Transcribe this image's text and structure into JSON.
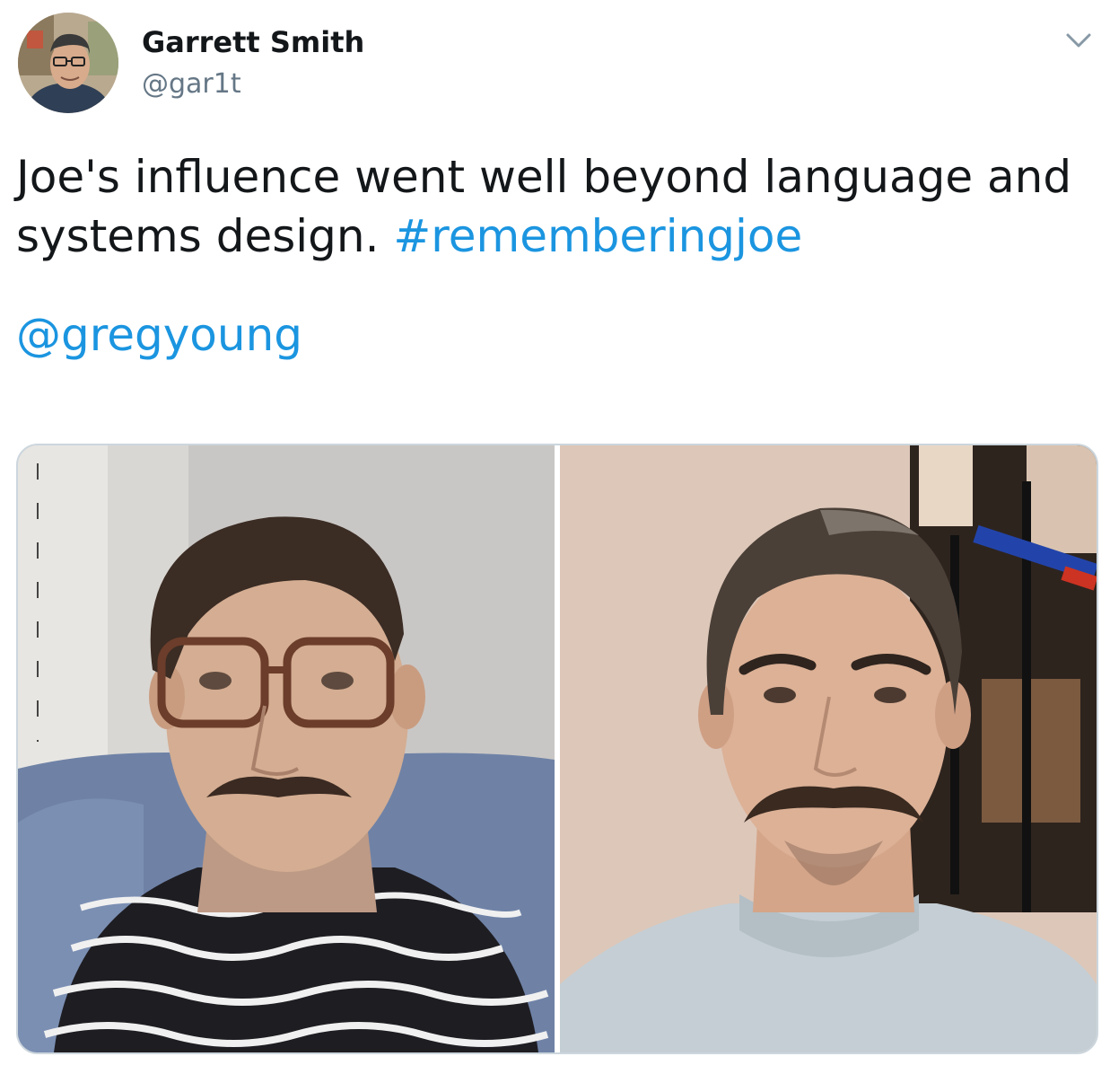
{
  "author": {
    "display_name": "Garrett Smith",
    "handle": "@gar1t"
  },
  "tweet": {
    "text_line1": "Joe's influence went well beyond language and",
    "text_line2_prefix": "systems design. ",
    "hashtag": "#rememberingjoe",
    "mention": "@gregyoung"
  },
  "media": {
    "photos": [
      "photo-left",
      "photo-right"
    ]
  },
  "icons": {
    "menu": "chevron-down-icon"
  },
  "colors": {
    "text": "#14171a",
    "secondary_text": "#657786",
    "link": "#1b95e0",
    "border": "#ccd6dd"
  }
}
